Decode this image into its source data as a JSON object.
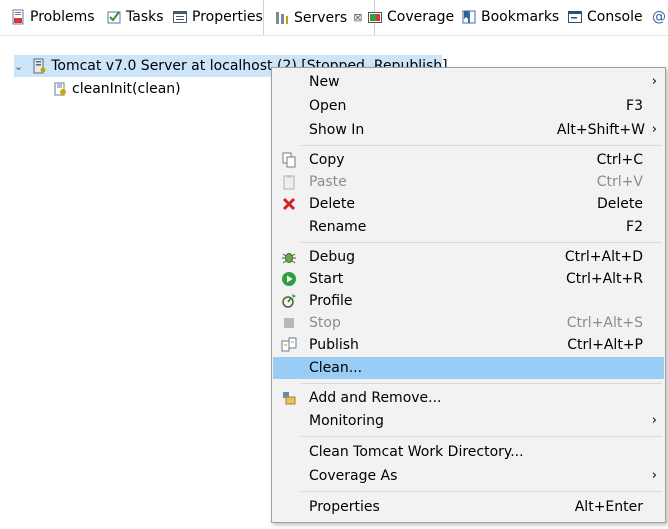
{
  "tabs": [
    {
      "label": "Problems",
      "icon": "problems-icon",
      "active": false
    },
    {
      "label": "Tasks",
      "icon": "tasks-icon",
      "active": false
    },
    {
      "label": "Properties",
      "icon": "properties-icon",
      "active": false
    },
    {
      "label": "Servers",
      "icon": "servers-icon",
      "active": true,
      "close": "⊠"
    },
    {
      "label": "Coverage",
      "icon": "coverage-icon",
      "active": false
    },
    {
      "label": "Bookmarks",
      "icon": "bookmarks-icon",
      "active": false
    },
    {
      "label": "Console",
      "icon": "console-icon",
      "active": false
    },
    {
      "label": "@",
      "icon": "",
      "active": false
    }
  ],
  "tree": {
    "server": {
      "label": "Tomcat v7.0 Server at localhost (2)  [Stopped, Republish]",
      "expanded": true
    },
    "module": {
      "label": "cleanInit(clean)"
    }
  },
  "menu": {
    "items": [
      {
        "label": "New",
        "accel": "",
        "submenu": true
      },
      {
        "label": "Open",
        "accel": "F3"
      },
      {
        "label": "Show In",
        "accel": "Alt+Shift+W",
        "submenu": true
      },
      {
        "label": "Copy",
        "accel": "Ctrl+C",
        "icon": "copy-icon"
      },
      {
        "label": "Paste",
        "accel": "Ctrl+V",
        "icon": "paste-icon",
        "disabled": true
      },
      {
        "label": "Delete",
        "accel": "Delete",
        "icon": "delete-icon"
      },
      {
        "label": "Rename",
        "accel": "F2"
      },
      {
        "label": "Debug",
        "accel": "Ctrl+Alt+D",
        "icon": "debug-icon"
      },
      {
        "label": "Start",
        "accel": "Ctrl+Alt+R",
        "icon": "start-icon"
      },
      {
        "label": "Profile",
        "accel": "",
        "icon": "profile-icon"
      },
      {
        "label": "Stop",
        "accel": "Ctrl+Alt+S",
        "icon": "stop-icon",
        "disabled": true
      },
      {
        "label": "Publish",
        "accel": "Ctrl+Alt+P",
        "icon": "publish-icon"
      },
      {
        "label": "Clean...",
        "accel": "",
        "highlighted": true
      },
      {
        "label": "Add and Remove...",
        "accel": "",
        "icon": "add-remove-icon"
      },
      {
        "label": "Monitoring",
        "accel": "",
        "submenu": true
      },
      {
        "label": "Clean Tomcat Work Directory...",
        "accel": ""
      },
      {
        "label": "Coverage As",
        "accel": "",
        "submenu": true
      },
      {
        "label": "Properties",
        "accel": "Alt+Enter"
      }
    ],
    "submenu_arrow": "›"
  },
  "colors": {
    "selection": "#cce5fb",
    "menu_bg": "#f2f2f2",
    "menu_highlight": "#99cdf6",
    "disabled_text": "#8c8c8c"
  }
}
